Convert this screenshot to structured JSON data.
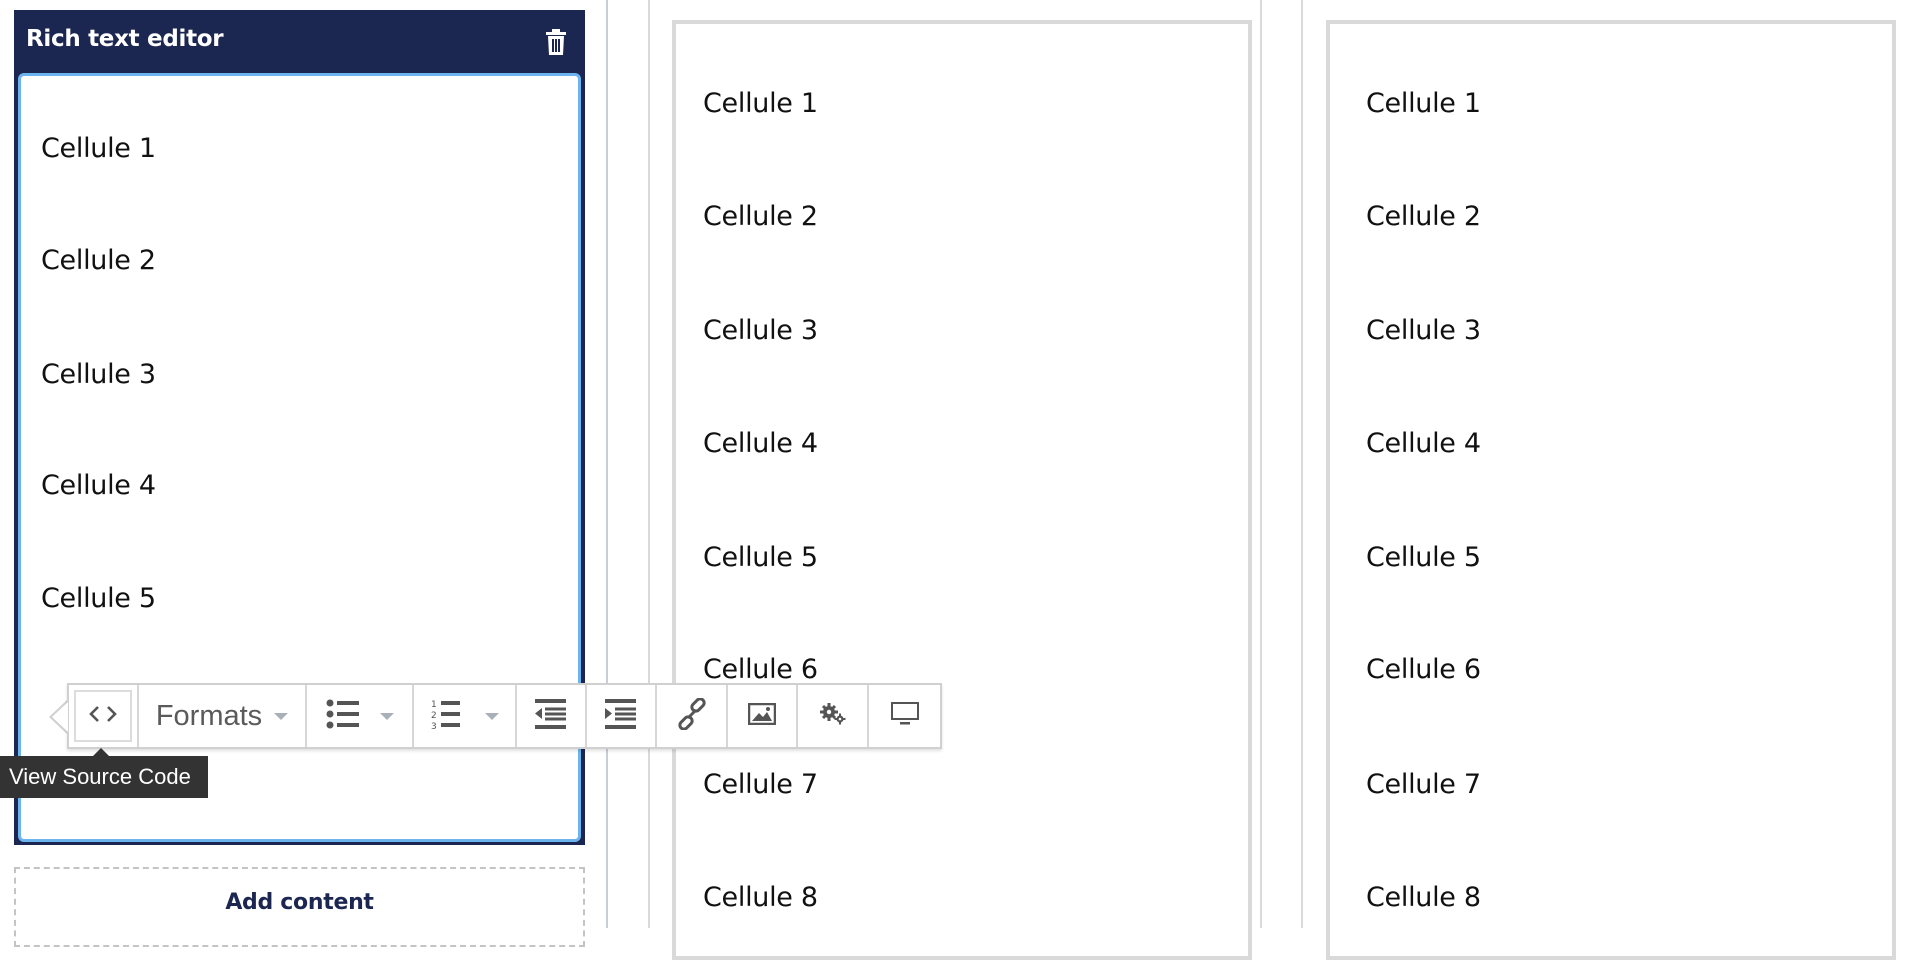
{
  "editor_panel": {
    "title": "Rich text editor",
    "delete_icon": "trash-icon",
    "cells": [
      "Cellule 1",
      "Cellule 2",
      "Cellule 3",
      "Cellule 4",
      "Cellule 5"
    ],
    "add_content_label": "Add content"
  },
  "toolbar": {
    "buttons": [
      {
        "name": "source-code",
        "icon": "code-icon"
      },
      {
        "name": "formats",
        "label": "Formats",
        "icon": "caret-down-icon"
      },
      {
        "name": "bullet-list",
        "icon": "bullet-list-icon"
      },
      {
        "name": "numbered-list",
        "icon": "numbered-list-icon"
      },
      {
        "name": "outdent",
        "icon": "outdent-icon"
      },
      {
        "name": "indent",
        "icon": "indent-icon"
      },
      {
        "name": "link",
        "icon": "link-icon"
      },
      {
        "name": "image",
        "icon": "image-icon"
      },
      {
        "name": "settings",
        "icon": "gears-icon"
      },
      {
        "name": "preview",
        "icon": "monitor-icon"
      }
    ],
    "formats_label": "Formats",
    "tooltip": "View Source Code"
  },
  "columns": [
    {
      "cells": [
        "Cellule 1",
        "Cellule 2",
        "Cellule 3",
        "Cellule 4",
        "Cellule 5",
        "Cellule 6",
        "Cellule 7",
        "Cellule 8"
      ]
    },
    {
      "cells": [
        "Cellule 1",
        "Cellule 2",
        "Cellule 3",
        "Cellule 4",
        "Cellule 5",
        "Cellule 6",
        "Cellule 7",
        "Cellule 8"
      ]
    }
  ],
  "colors": {
    "header_bg": "#1c2751",
    "focus_border": "#6cb4ee",
    "box_border": "#d9d9d9",
    "tooltip_bg": "#333333"
  }
}
